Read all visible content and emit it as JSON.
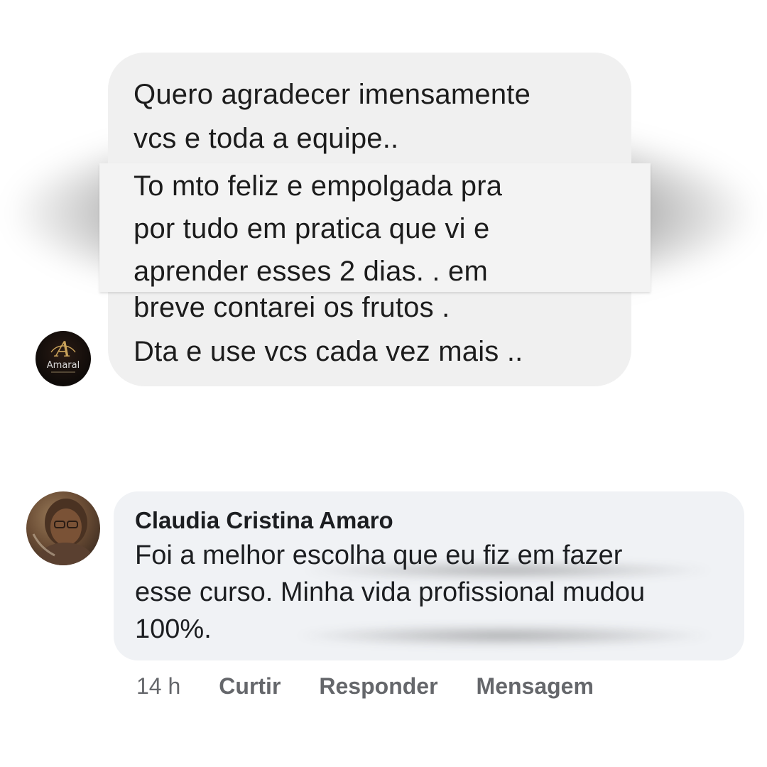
{
  "message": {
    "lines_top": [
      "Quero agradecer imensamente",
      "vcs e toda a equipe.."
    ],
    "lines_highlight": [
      "To mto feliz e empolgada pra",
      "por tudo em pratica que vi e",
      "aprender esses 2 dias. . em"
    ],
    "lines_bottom": [
      "breve contarei os frutos .",
      "Dta e use vcs cada vez mais .."
    ],
    "avatar": {
      "icon": "amaral-logo-avatar",
      "logo_text": "Amaral",
      "logo_initial": "A"
    }
  },
  "comment": {
    "author": "Claudia Cristina Amaro",
    "text_lines": [
      "Foi a melhor escolha que eu fiz em fazer",
      "esse curso. Minha vida profissional mudou",
      "100%."
    ],
    "avatar": {
      "icon": "user-photo-avatar"
    },
    "actions": {
      "time": "14 h",
      "like": "Curtir",
      "reply": "Responder",
      "message": "Mensagem"
    }
  },
  "colors": {
    "bubble_gray": "#f0f0f0",
    "comment_bubble": "#f0f2f5",
    "text": "#1c1c1c",
    "action_text": "#65676b",
    "logo_gold": "#c9a25a"
  }
}
